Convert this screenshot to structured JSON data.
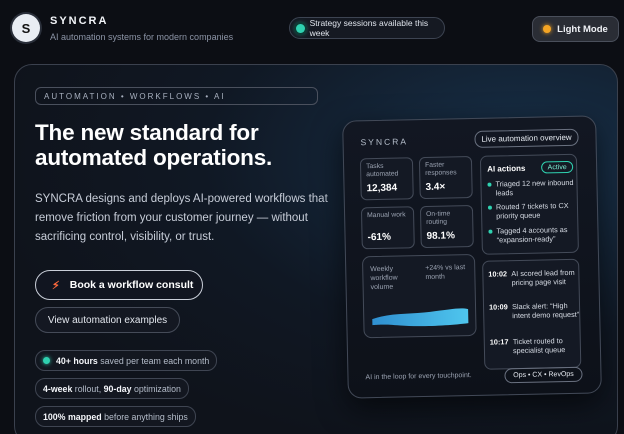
{
  "header": {
    "logo_letter": "S",
    "brand_name": "SYNCRA",
    "tagline": "AI automation systems for modern companies",
    "notice": "Strategy sessions available this week",
    "mode_button": "Light Mode"
  },
  "hero": {
    "kicker": "AUTOMATION • WORKFLOWS • AI",
    "headline": "The new standard for automated operations.",
    "description": "SYNCRA designs and deploys AI-powered workflows that remove friction from your customer journey — without sacrificing control, visibility, or trust.",
    "cta_label": "Book a workflow consult",
    "secondary_label": "View automation examples",
    "pills": [
      {
        "strong": "40+ hours",
        "rest": " saved per team each month"
      },
      {
        "strong1": "4-week",
        "mid": " rollout, ",
        "strong2": "90-day",
        "rest": " optimization"
      },
      {
        "strong": "100% mapped",
        "rest": " before anything ships"
      }
    ]
  },
  "dashboard": {
    "brand": "SYNCRA",
    "overview_button": "Live automation overview",
    "metrics": [
      {
        "label": "Tasks automated",
        "value": "12,384"
      },
      {
        "label": "Faster responses",
        "value": "3.4×"
      },
      {
        "label": "Manual work",
        "value": "-61%"
      },
      {
        "label": "On-time routing",
        "value": "98.1%"
      }
    ],
    "volume": {
      "label": "Weekly workflow volume",
      "delta": "+24% vs last month"
    },
    "actions": {
      "title": "AI actions",
      "status": "Active",
      "items": [
        "Triaged 12 new inbound leads",
        "Routed 7 tickets to CX priority queue",
        "Tagged 4 accounts as “expansion-ready”"
      ]
    },
    "log": [
      {
        "time": "10:02",
        "text": "AI scored lead from pricing page visit"
      },
      {
        "time": "10:09",
        "text": "Slack alert: “High intent demo request”"
      },
      {
        "time": "10:17",
        "text": "Ticket routed to specialist queue"
      }
    ],
    "footnote": "AI in the loop for every touchpoint.",
    "tags": "Ops • CX • RevOps"
  },
  "colors": {
    "accent": "#2fd1b0",
    "cta_icon": "#ff6a3d",
    "mode_icon": "#f5a524",
    "wave": "#3fb6e8"
  }
}
